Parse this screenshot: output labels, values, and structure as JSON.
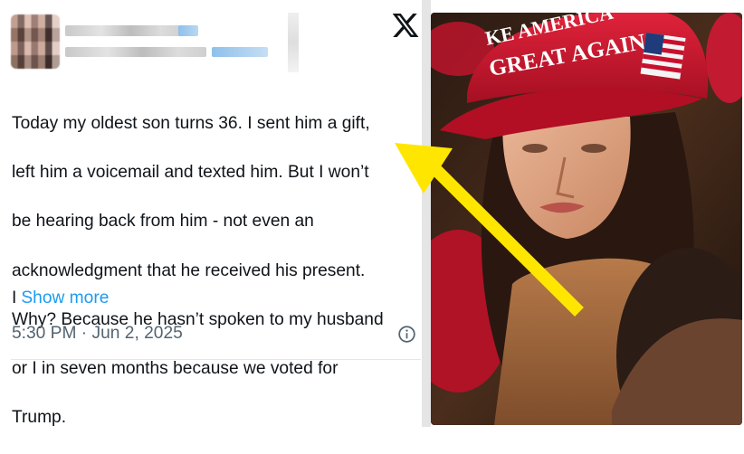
{
  "tweet": {
    "brand_icon": "x-logo-icon",
    "body_lines": [
      "Today my oldest son turns 36. I sent him a gift,",
      "left him a voicemail and texted him. But I won’t",
      "be hearing back from him - not even an",
      "acknowledgment that he received his present.",
      "Why? Because he hasn’t spoken to my husband",
      "or I in seven months because we voted for",
      "Trump."
    ],
    "truncated_prefix": "I",
    "show_more_label": "Show more",
    "timestamp": "5:30 PM · Jun 2, 2025",
    "info_icon": "info-circle-icon",
    "link_color": "#1d9bf0"
  },
  "photo": {
    "hat_text_line1": "KE AMERICA",
    "hat_text_line2": "GREAT AGAIN",
    "hat_color": "#c8102e",
    "arrow_color": "#ffe600"
  }
}
